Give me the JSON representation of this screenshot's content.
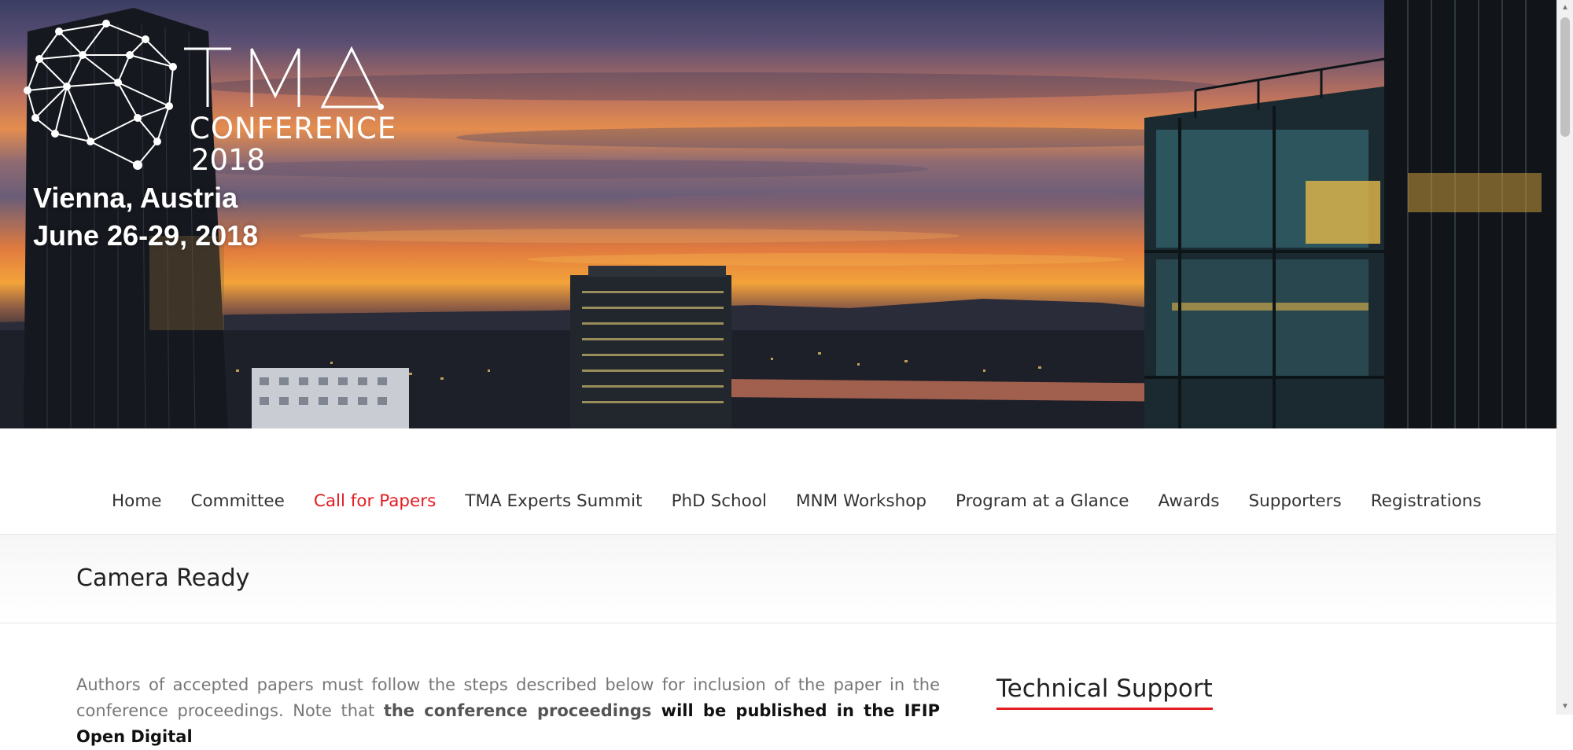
{
  "hero": {
    "logo_text": "TMA",
    "conference_word": "CONFERENCE",
    "conference_year": "2018",
    "city": "Vienna, Austria",
    "dates": "June 26-29, 2018"
  },
  "nav": {
    "items": [
      {
        "label": "Home",
        "active": false
      },
      {
        "label": "Committee",
        "active": false
      },
      {
        "label": "Call for Papers",
        "active": true
      },
      {
        "label": "TMA Experts Summit",
        "active": false
      },
      {
        "label": "PhD School",
        "active": false
      },
      {
        "label": "MNM Workshop",
        "active": false
      },
      {
        "label": "Program at a Glance",
        "active": false
      },
      {
        "label": "Awards",
        "active": false
      },
      {
        "label": "Supporters",
        "active": false
      },
      {
        "label": "Registrations",
        "active": false
      }
    ]
  },
  "page": {
    "title": "Camera Ready"
  },
  "content": {
    "p1_text": "Authors of accepted papers must follow the steps described below for inclusion of the paper in the conference proceedings. Note that ",
    "p1_bold_1": "the conference proceedings",
    "p1_bold_2": " will be published in the IFIP Open Digital"
  },
  "sidebar": {
    "title": "Technical Support"
  },
  "colors": {
    "accent": "#e21e23",
    "nav_text": "#333333",
    "body_text": "#777777"
  },
  "icons": {
    "scroll_up": "triangle-up",
    "scroll_down": "triangle-down"
  }
}
